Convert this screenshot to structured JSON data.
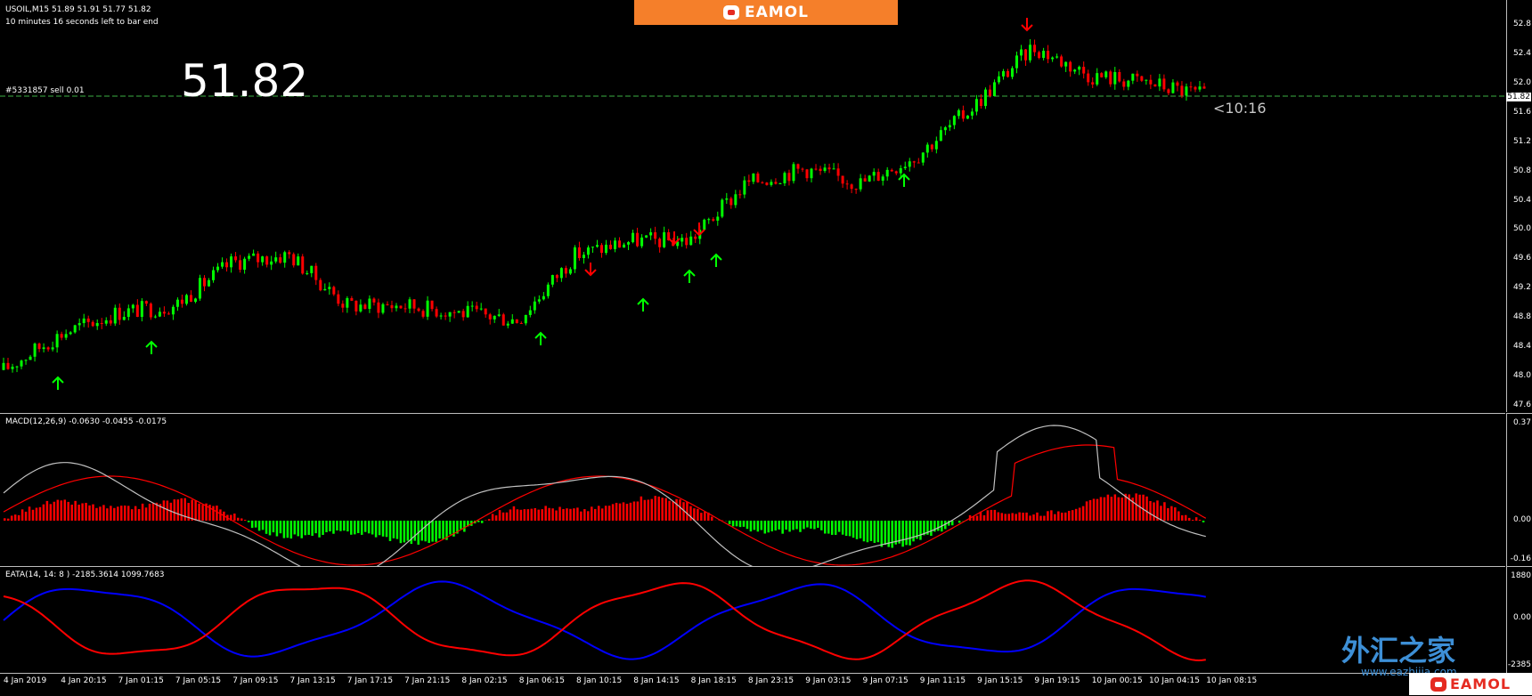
{
  "symbol_header": {
    "title": "USOIL,M15  51.89 51.91 51.77 51.82",
    "countdown_text": "10 minutes 16 seconds left to bar end"
  },
  "order_line": {
    "label": "#5331857 sell 0.01"
  },
  "big_price": "51.82",
  "bar_countdown": "<10:16",
  "brand": {
    "name": "EAMOL",
    "accent": "#f57f2a"
  },
  "watermark": {
    "text": "外汇之家",
    "url": "www.eazhijia.com"
  },
  "price_axis": [
    "52.8",
    "52.4",
    "52.0",
    "51.6",
    "51.2",
    "50.8",
    "50.4",
    "50.0",
    "49.6",
    "49.2",
    "48.8",
    "48.4",
    "48.0",
    "47.6"
  ],
  "current_price_tag": "51.82",
  "macd": {
    "title": "MACD(12,26,9) -0.0630 -0.0455 -0.0175",
    "axis": [
      "0.37",
      "0.00",
      "-0.16"
    ]
  },
  "eata": {
    "title": "EATA(14, 14: 8 ) -2185.3614 1099.7683",
    "axis": [
      "1880",
      "0.00",
      "-2385"
    ]
  },
  "time_axis": [
    "4 Jan 2019",
    "4 Jan 20:15",
    "7 Jan 01:15",
    "7 Jan 05:15",
    "7 Jan 09:15",
    "7 Jan 13:15",
    "7 Jan 17:15",
    "7 Jan 21:15",
    "8 Jan 02:15",
    "8 Jan 06:15",
    "8 Jan 10:15",
    "8 Jan 14:15",
    "8 Jan 18:15",
    "8 Jan 23:15",
    "9 Jan 03:15",
    "9 Jan 07:15",
    "9 Jan 11:15",
    "9 Jan 15:15",
    "9 Jan 19:15",
    "10 Jan 00:15",
    "10 Jan 04:15",
    "10 Jan 08:15"
  ],
  "colors": {
    "bull": "#00ff00",
    "bear": "#ff0000",
    "order_line": "#3cb043",
    "macd_main": "#c0c0c0",
    "macd_signal": "#ff0000",
    "eata_blue": "#0000ff",
    "eata_red": "#ff0000"
  },
  "chart_data": {
    "type": "line",
    "title": "USOIL,M15",
    "ylim": [
      47.6,
      52.9
    ],
    "x": [
      "4 Jan 2019",
      "4 Jan 20:15",
      "7 Jan 01:15",
      "7 Jan 05:15",
      "7 Jan 09:15",
      "7 Jan 13:15",
      "7 Jan 17:15",
      "7 Jan 21:15",
      "8 Jan 02:15",
      "8 Jan 06:15",
      "8 Jan 10:15",
      "8 Jan 14:15",
      "8 Jan 18:15",
      "8 Jan 23:15",
      "9 Jan 03:15",
      "9 Jan 07:15",
      "9 Jan 11:15",
      "9 Jan 15:15",
      "9 Jan 19:15",
      "10 Jan 00:15",
      "10 Jan 04:15",
      "10 Jan 08:15"
    ],
    "series": [
      {
        "name": "USOIL,M15",
        "values": [
          48.0,
          48.5,
          48.8,
          48.9,
          49.5,
          49.6,
          48.9,
          48.9,
          48.8,
          48.7,
          49.6,
          49.8,
          49.8,
          50.6,
          50.8,
          50.6,
          51.0,
          51.7,
          52.5,
          52.1,
          52.0,
          51.82
        ]
      }
    ]
  }
}
